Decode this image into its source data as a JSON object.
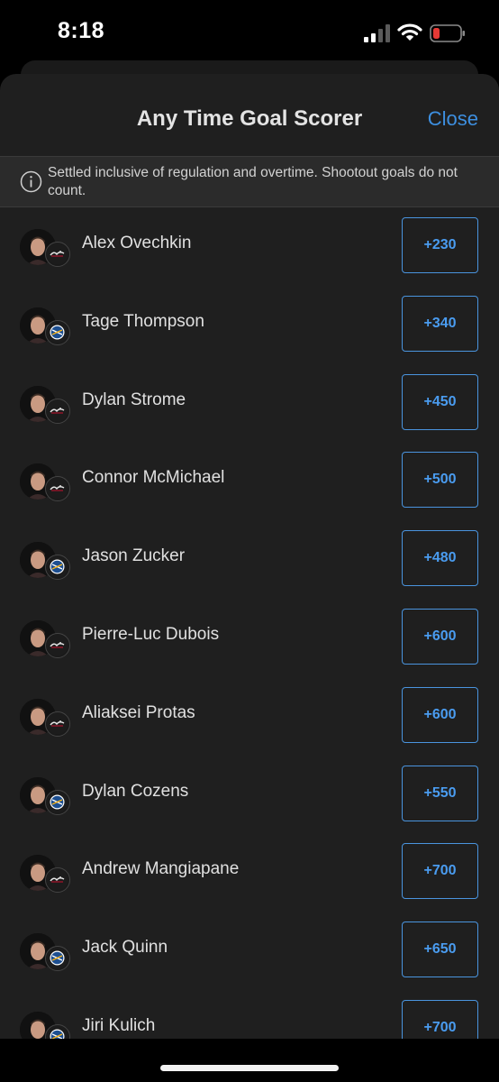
{
  "status_bar": {
    "time": "8:18",
    "icons": [
      "signal-icon",
      "wifi-icon",
      "battery-icon"
    ],
    "battery_color": "#e53935"
  },
  "sheet": {
    "title": "Any Time Goal Scorer",
    "close_label": "Close",
    "info_icon": "info-icon",
    "info_text": "Settled inclusive of regulation and overtime. Shootout goals do not count."
  },
  "colors": {
    "accent": "#3d8fe0",
    "background": "#1f1f1f",
    "banner": "#2b2b2b"
  },
  "players": [
    {
      "name": "Alex Ovechkin",
      "odds": "+230",
      "team_logo": "capitals-logo-icon"
    },
    {
      "name": "Tage Thompson",
      "odds": "+340",
      "team_logo": "sabres-logo-icon"
    },
    {
      "name": "Dylan Strome",
      "odds": "+450",
      "team_logo": "capitals-logo-icon"
    },
    {
      "name": "Connor McMichael",
      "odds": "+500",
      "team_logo": "capitals-logo-icon"
    },
    {
      "name": "Jason Zucker",
      "odds": "+480",
      "team_logo": "sabres-logo-icon"
    },
    {
      "name": "Pierre-Luc Dubois",
      "odds": "+600",
      "team_logo": "capitals-logo-icon"
    },
    {
      "name": "Aliaksei Protas",
      "odds": "+600",
      "team_logo": "capitals-logo-icon"
    },
    {
      "name": "Dylan Cozens",
      "odds": "+550",
      "team_logo": "sabres-logo-icon"
    },
    {
      "name": "Andrew Mangiapane",
      "odds": "+700",
      "team_logo": "capitals-logo-icon"
    },
    {
      "name": "Jack Quinn",
      "odds": "+650",
      "team_logo": "sabres-logo-icon"
    },
    {
      "name": "Jiri Kulich",
      "odds": "+700",
      "team_logo": "sabres-logo-icon"
    }
  ]
}
